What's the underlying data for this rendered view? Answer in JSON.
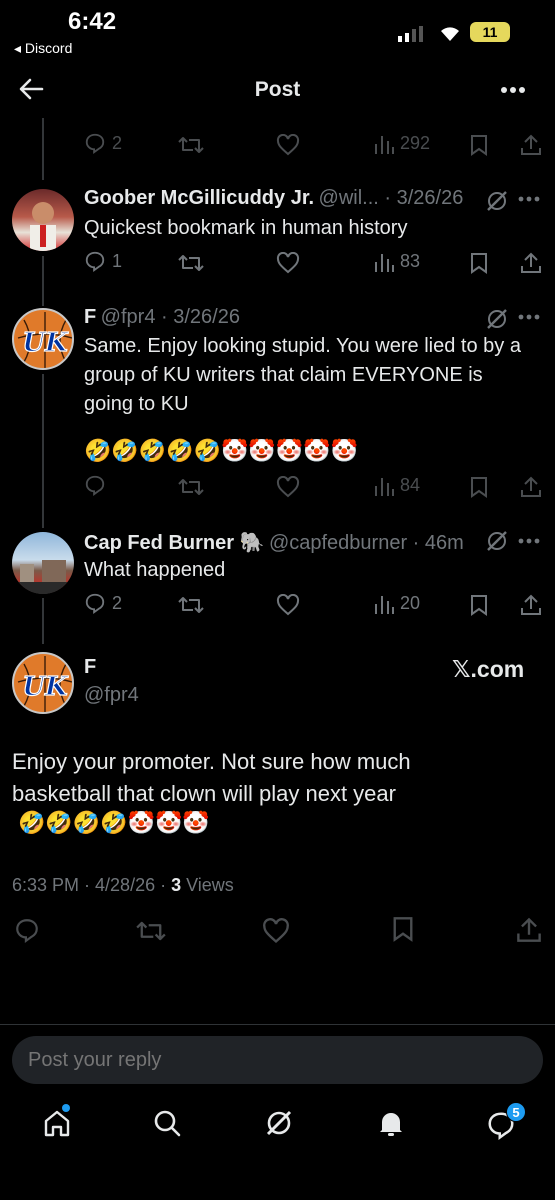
{
  "status_bar": {
    "time": "6:42",
    "back_app": "◂ Discord",
    "battery": "11"
  },
  "header": {
    "title": "Post"
  },
  "top_actions": {
    "replies": "2",
    "views": "292"
  },
  "posts": [
    {
      "name": "Goober McGillicuddy Jr.",
      "handle": "@wil... · 3/26/26",
      "text": "Quickest bookmark in human history",
      "replies": "1",
      "views": "83"
    },
    {
      "name": "F",
      "handle": "@fpr4 · 3/26/26",
      "text": "Same. Enjoy looking stupid. You were lied to by a group of KU writers that claim EVERYONE is going to KU",
      "emojis": "🤣🤣🤣🤣🤣🤡🤡🤡🤡🤡",
      "views": "84"
    },
    {
      "name": "Cap Fed Burner 🐘",
      "handle": "@capfedburner · 46m",
      "text": "What happened",
      "replies": "2",
      "views": "20"
    }
  ],
  "main_post": {
    "name": "F",
    "handle": "@fpr4",
    "watermark": "𝕏.com",
    "text": "Enjoy your promoter. Not sure how much basketball that clown will play next year",
    "emojis": "🤣🤣🤣🤣🤡🤡🤡",
    "time": "6:33 PM · 4/28/26 · ",
    "views_count": "3",
    "views_label": " Views"
  },
  "reply": {
    "placeholder": "Post your reply"
  },
  "tab_bar": {
    "messages_badge": "5"
  },
  "avatar_initials": "UK",
  "colors": {
    "background": "#000000",
    "text": "#e7e9ea",
    "muted": "#71767b",
    "accent": "#1d9bf0",
    "uk_blue": "#0033a0",
    "uk_orange": "#e07a2a"
  }
}
